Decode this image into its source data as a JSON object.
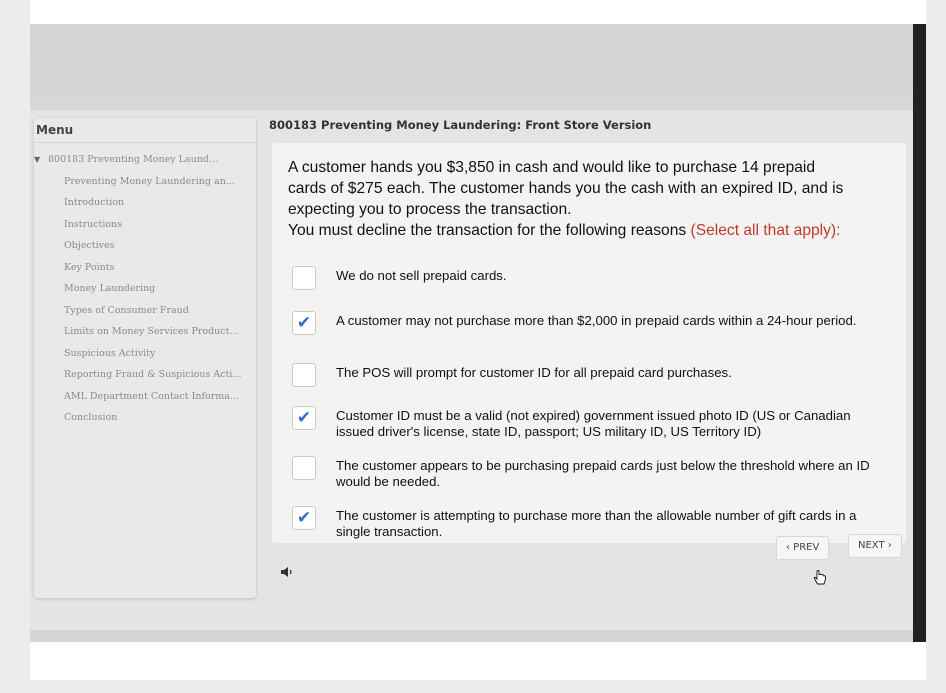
{
  "menu": {
    "header": "Menu",
    "items": [
      {
        "label": "800183 Preventing Money Launderi..."
      },
      {
        "label": "Preventing Money Laundering an..."
      },
      {
        "label": "Introduction"
      },
      {
        "label": "Instructions"
      },
      {
        "label": "Objectives"
      },
      {
        "label": "Key Points"
      },
      {
        "label": "Money Laundering"
      },
      {
        "label": "Types of Consumer Fraud"
      },
      {
        "label": "Limits on Money Services Product..."
      },
      {
        "label": "Suspicious Activity"
      },
      {
        "label": "Reporting Fraud & Suspicious Acti..."
      },
      {
        "label": "AML Department Contact Informa..."
      },
      {
        "label": "Conclusion"
      }
    ]
  },
  "course_title": "800183 Preventing Money Laundering: Front Store Version",
  "question": {
    "line1": "A customer hands you $3,850 in cash and would like to purchase 14 prepaid",
    "line2": "cards of $275 each. The customer hands you the cash with an expired ID, and is",
    "line3": "expecting you to process the transaction.",
    "prompt": "You must decline the transaction for the following reasons",
    "select_note": "(Select all that apply):"
  },
  "options": [
    {
      "text": "We do not sell prepaid cards.",
      "checked": false,
      "mark": ""
    },
    {
      "text": "A customer may not purchase more than $2,000 in prepaid cards within a 24-hour period.",
      "checked": true,
      "mark": "✔"
    },
    {
      "text": "The POS will prompt for customer ID for all prepaid card purchases.",
      "checked": false,
      "mark": ""
    },
    {
      "text": "Customer ID must be a valid (not expired) government issued photo ID (US or Canadian issued driver's license, state ID, passport; US military ID, US Territory ID)",
      "checked": true,
      "mark": "✔"
    },
    {
      "text": "The customer appears to be purchasing prepaid cards just below the threshold where an ID would be needed.",
      "checked": false,
      "mark": ""
    },
    {
      "text": "The customer is attempting to purchase more than the allowable number of gift cards in a single transaction.",
      "checked": true,
      "mark": "✔"
    }
  ],
  "nav": {
    "prev_label": "‹ PREV",
    "next_label": "NEXT ›"
  },
  "icons": {
    "audio": "speaker-icon",
    "cursor": "hand-cursor-icon",
    "check": "checkmark-icon"
  },
  "colors": {
    "accent_red": "#c0392b",
    "check_blue": "#2f6fc4"
  }
}
